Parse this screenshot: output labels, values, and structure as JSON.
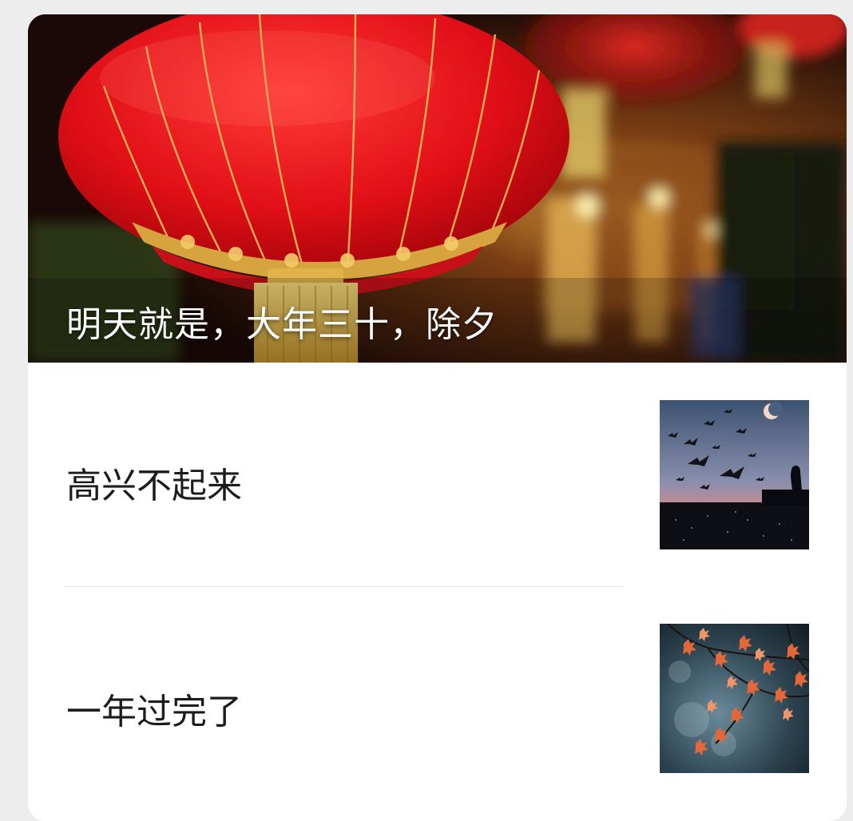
{
  "hero": {
    "title": "明天就是，大年三十，除夕",
    "image_icon": "red-lantern-night-icon"
  },
  "items": [
    {
      "title": "高兴不起来",
      "thumb_icon": "birds-moon-silhouette-icon"
    },
    {
      "title": "一年过完了",
      "thumb_icon": "autumn-maple-leaves-icon"
    }
  ],
  "colors": {
    "lantern_red": "#e8101a",
    "lantern_gold": "#e8b64a",
    "card_bg": "#ffffff",
    "page_bg": "#ededed",
    "title_text": "#1c1c1c"
  }
}
